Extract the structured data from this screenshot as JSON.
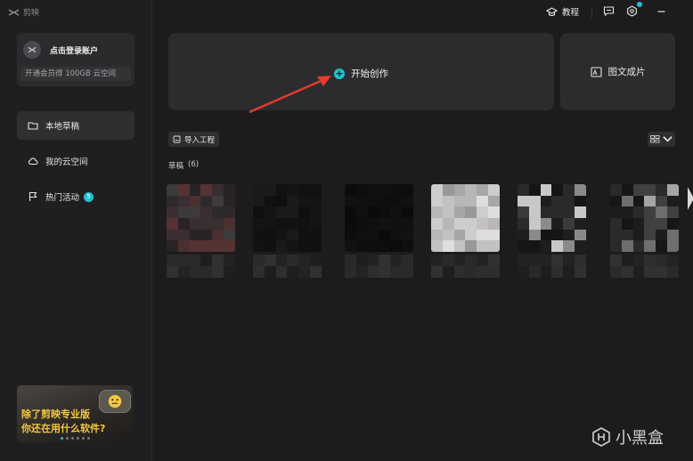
{
  "app": {
    "title": "剪映"
  },
  "account": {
    "login_title": "点击登录账户",
    "login_sub": "开通会员得 100GB 云空间"
  },
  "sidebar": {
    "items": [
      {
        "label": "本地草稿",
        "icon": "folder-icon",
        "active": true
      },
      {
        "label": "我的云空间",
        "icon": "cloud-icon",
        "active": false
      },
      {
        "label": "热门活动",
        "icon": "flag-icon",
        "active": false,
        "badge": "5"
      }
    ]
  },
  "banner": {
    "line1": "除了剪映专业版",
    "line2": "你还在用什么软件?",
    "page_count": 6,
    "active_page": 0
  },
  "topbar": {
    "tutorial_label": "教程",
    "icons": [
      "tutorial-icon",
      "feedback-icon",
      "settings-icon",
      "minimize-icon"
    ]
  },
  "main": {
    "create_label": "开始创作",
    "template_label": "图文成片",
    "import_label": "导入工程",
    "drafts_title": "草稿",
    "drafts_count": "(6)"
  },
  "watermark": {
    "text": "小黑盒"
  },
  "colors": {
    "accent": "#21c2d0",
    "annotation_arrow": "#e33b2f",
    "background": "#1c1c1e",
    "card": "#2c2c2f"
  }
}
